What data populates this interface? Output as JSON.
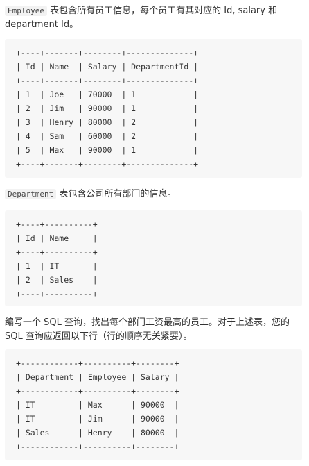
{
  "intro": {
    "code": "Employee",
    "text_line1": " 表包含所有员工信息，每个员工有其对应的 Id, salary 和",
    "text_line2": "department Id。"
  },
  "employee_table": {
    "lines": [
      "+----+-------+--------+--------------+",
      "| Id | Name  | Salary | DepartmentId |",
      "+----+-------+--------+--------------+",
      "| 1  | Joe   | 70000  | 1            |",
      "| 2  | Jim   | 90000  | 1            |",
      "| 3  | Henry | 80000  | 2            |",
      "| 4  | Sam   | 60000  | 2            |",
      "| 5  | Max   | 90000  | 1            |",
      "+----+-------+--------+--------------+"
    ]
  },
  "department_intro": {
    "code": "Department",
    "text": " 表包含公司所有部门的信息。"
  },
  "department_table": {
    "lines": [
      "+----+----------+",
      "| Id | Name     |",
      "+----+----------+",
      "| 1  | IT       |",
      "| 2  | Sales    |",
      "+----+----------+"
    ]
  },
  "question": {
    "line1": "编写一个 SQL 查询，找出每个部门工资最高的员工。对于上述表，您的",
    "line2": "SQL 查询应返回以下行（行的顺序无关紧要）。"
  },
  "result_table": {
    "lines": [
      "+------------+----------+--------+",
      "| Department | Employee | Salary |",
      "+------------+----------+--------+",
      "| IT         | Max      | 90000  |",
      "| IT         | Jim      | 90000  |",
      "| Sales      | Henry    | 80000  |",
      "+------------+----------+--------+"
    ]
  }
}
